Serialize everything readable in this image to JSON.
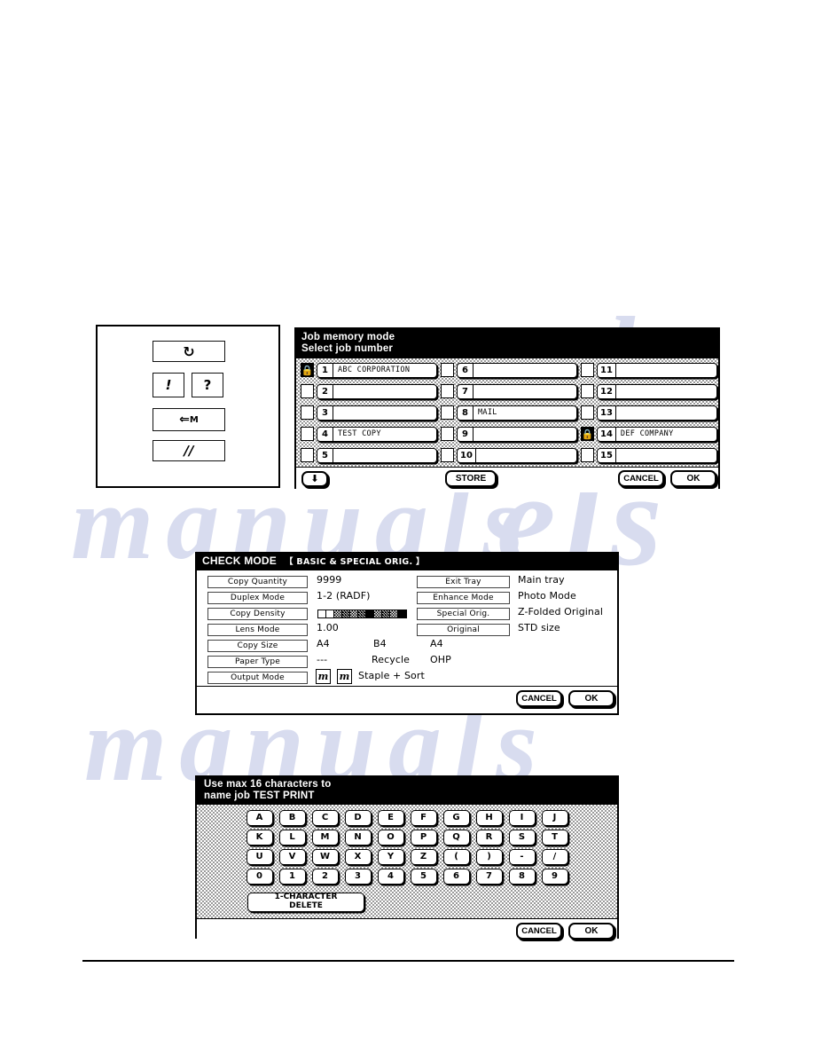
{
  "legend": {
    "keys": [
      {
        "name": "reset-key",
        "glyph": "↻",
        "label": "reset"
      },
      {
        "name": "alert-key",
        "glyph": "!",
        "label": "alert"
      },
      {
        "name": "help-key",
        "glyph": "?",
        "label": "help"
      },
      {
        "name": "memory-key",
        "glyph": "⇐",
        "label": "M"
      },
      {
        "name": "interrupt-key",
        "glyph": "∕∕",
        "label": "interrupt"
      }
    ]
  },
  "job_memory": {
    "title_line1": "Job memory mode",
    "title_line2": "Select job number",
    "columns": [
      [
        {
          "num": "1",
          "name": "ABC CORPORATION",
          "locked": true
        },
        {
          "num": "2",
          "name": "",
          "locked": false
        },
        {
          "num": "3",
          "name": "",
          "locked": false
        },
        {
          "num": "4",
          "name": "TEST COPY",
          "locked": false
        },
        {
          "num": "5",
          "name": "",
          "locked": false
        }
      ],
      [
        {
          "num": "6",
          "name": "",
          "locked": false
        },
        {
          "num": "7",
          "name": "",
          "locked": false
        },
        {
          "num": "8",
          "name": "MAIL",
          "locked": false
        },
        {
          "num": "9",
          "name": "",
          "locked": false
        },
        {
          "num": "10",
          "name": "",
          "locked": false
        }
      ],
      [
        {
          "num": "11",
          "name": "",
          "locked": false
        },
        {
          "num": "12",
          "name": "",
          "locked": false
        },
        {
          "num": "13",
          "name": "",
          "locked": false
        },
        {
          "num": "14",
          "name": "DEF COMPANY",
          "locked": true
        },
        {
          "num": "15",
          "name": "",
          "locked": false
        }
      ]
    ],
    "scroll_down_glyph": "⬇",
    "store_label": "STORE",
    "cancel_label": "CANCEL",
    "ok_label": "OK"
  },
  "check_mode": {
    "title": "CHECK MODE",
    "title_sub": "【 BASIC  &  SPECIAL ORIG. 】",
    "left_rows": [
      {
        "label": "Copy Quantity",
        "value": "9999"
      },
      {
        "label": "Duplex Mode",
        "value": "1-2   (RADF)"
      },
      {
        "label": "Copy Density",
        "value": ""
      },
      {
        "label": "Lens Mode",
        "value": "1.00"
      },
      {
        "label": "Copy Size",
        "value": "A4"
      },
      {
        "label": "Paper Type",
        "value": "---"
      },
      {
        "label": "Output Mode",
        "value": "Staple + Sort"
      }
    ],
    "copy_size_extra": [
      "B4",
      "A4"
    ],
    "paper_type_extra": [
      "Recycle",
      "OHP"
    ],
    "density_segments": [
      "white",
      "white",
      "light",
      "mid",
      "light",
      "mid",
      "black",
      "light",
      "mid",
      "light",
      "black"
    ],
    "staple_icons": [
      "staple-icon-1",
      "staple-icon-2"
    ],
    "right_rows": [
      {
        "label": "Exit Tray",
        "value": "Main tray"
      },
      {
        "label": "Enhance Mode",
        "value": "Photo Mode"
      },
      {
        "label": "Special Orig.",
        "value": "Z-Folded Original"
      },
      {
        "label": "Original",
        "value": "STD size"
      }
    ],
    "cancel_label": "CANCEL",
    "ok_label": "OK"
  },
  "keyboard": {
    "title_line1": "Use max 16 characters to",
    "title_line2": "name job  TEST PRINT",
    "job_name": "TEST PRINT",
    "max_characters": 16,
    "rows": [
      [
        "A",
        "B",
        "C",
        "D",
        "E",
        "F",
        "G",
        "H",
        "I",
        "J"
      ],
      [
        "K",
        "L",
        "M",
        "N",
        "O",
        "P",
        "Q",
        "R",
        "S",
        "T"
      ],
      [
        "U",
        "V",
        "W",
        "X",
        "Y",
        "Z",
        "(",
        ")",
        "-",
        "/"
      ],
      [
        "0",
        "1",
        "2",
        "3",
        "4",
        "5",
        "6",
        "7",
        "8",
        "9"
      ]
    ],
    "delete_line1": "1-CHARACTER",
    "delete_line2": "DELETE",
    "cancel_label": "CANCEL",
    "ok_label": "OK"
  },
  "watermark": {
    "a": "els",
    "b": "manuals",
    "c": "manuals",
    "d": "els"
  }
}
